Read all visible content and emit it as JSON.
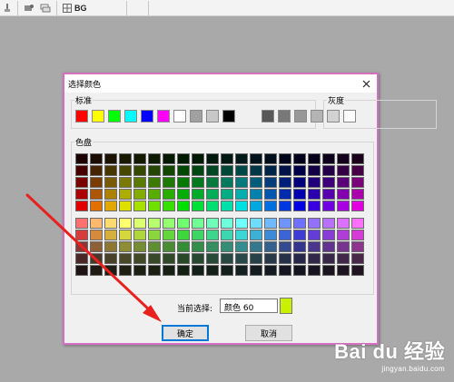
{
  "toolbar": {
    "bg_label": "BG",
    "icons": [
      "brush-icon",
      "layers-icon",
      "grid-icon"
    ]
  },
  "dialog": {
    "title": "选择颜色",
    "standard_label": "标准",
    "gray_label": "灰度",
    "panel_label": "色盘",
    "current_label": "当前选择:",
    "current_value": "颜色 60",
    "current_color": "#c8f000",
    "ok_label": "确定",
    "cancel_label": "取消",
    "border_color": "#d46fc2"
  },
  "standard_colors": [
    "#ff0000",
    "#ffff00",
    "#00ff00",
    "#00ffff",
    "#0000ff",
    "#ff00ff",
    "#ffffff",
    "#a0a0a0",
    "#c8c8c8",
    "#000000"
  ],
  "gray_colors": [
    "#585858",
    "#787878",
    "#989898",
    "#b4b4b4",
    "#d2d2d2",
    "#ffffff"
  ],
  "palette": {
    "hues": [
      0,
      30,
      45,
      60,
      75,
      90,
      105,
      120,
      135,
      150,
      165,
      180,
      195,
      210,
      225,
      240,
      255,
      270,
      285,
      300
    ],
    "top_rows": [
      {
        "s": 100,
        "l": 5
      },
      {
        "s": 100,
        "l": 14
      },
      {
        "s": 100,
        "l": 24
      },
      {
        "s": 100,
        "l": 34
      },
      {
        "s": 100,
        "l": 44
      }
    ],
    "bottom_rows": [
      {
        "s": 100,
        "l": 72
      },
      {
        "s": 65,
        "l": 54
      },
      {
        "s": 45,
        "l": 38
      },
      {
        "s": 30,
        "l": 22
      },
      {
        "s": 20,
        "l": 10
      }
    ]
  },
  "annotation_arrow_color": "#e8201e",
  "watermark": {
    "brand": "Bai du 经验",
    "url": "jingyan.baidu.com"
  }
}
